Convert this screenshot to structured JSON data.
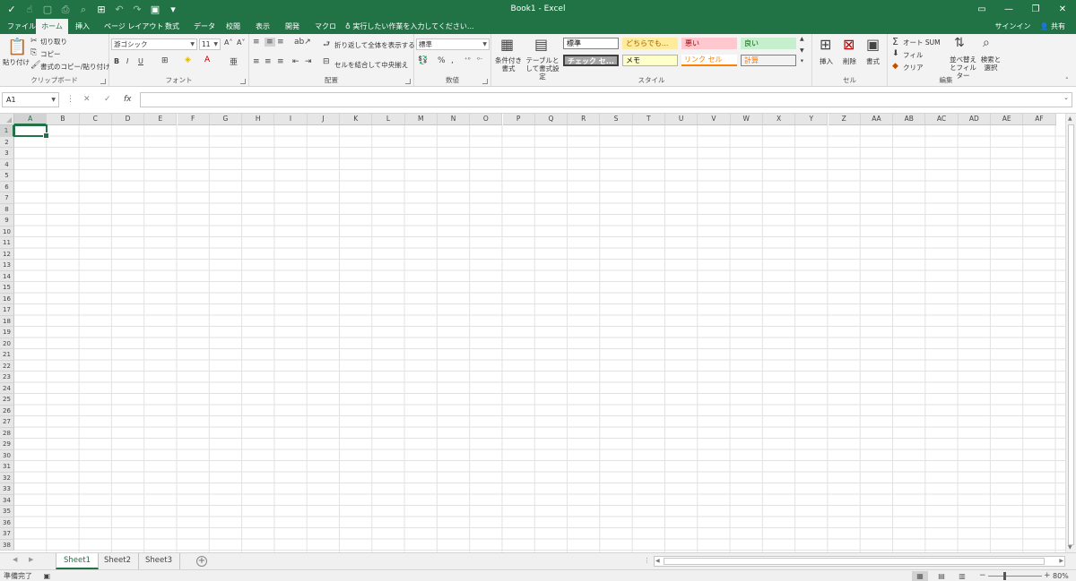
{
  "app": {
    "title": "Book1 - Excel"
  },
  "qat": {
    "check": "✓",
    "undo": "↶",
    "redo": "↷",
    "save": "💾",
    "more": "⇟"
  },
  "tabs": [
    {
      "label": "ファイル",
      "active": false
    },
    {
      "label": "ホーム",
      "active": true
    },
    {
      "label": "挿入",
      "active": false
    },
    {
      "label": "ページ レイアウト",
      "active": false
    },
    {
      "label": "数式",
      "active": false
    },
    {
      "label": "データ",
      "active": false
    },
    {
      "label": "校閲",
      "active": false
    },
    {
      "label": "表示",
      "active": false
    },
    {
      "label": "開発",
      "active": false
    },
    {
      "label": "マクロ",
      "active": false
    }
  ],
  "search": {
    "placeholder": "実行したい作業を入力してください..."
  },
  "account": {
    "signin": "サインイン",
    "share": "共有"
  },
  "ribbon": {
    "clipboard": {
      "label": "クリップボード",
      "paste": "貼り付け",
      "cut": "切り取り",
      "copy": "コピー",
      "format_painter": "書式のコピー/貼り付け"
    },
    "font": {
      "label": "フォント",
      "name": "游ゴシック",
      "size": "11",
      "bold": "B",
      "italic": "I",
      "underline": "U"
    },
    "alignment": {
      "label": "配置",
      "wrap": "折り返して全体を表示する",
      "merge": "セルを結合して中央揃え"
    },
    "number": {
      "label": "数値",
      "format": "標準",
      "percent": "%",
      "comma": ","
    },
    "styles": {
      "label": "スタイル",
      "conditional": "条件付き書式",
      "table": "テーブルとして書式設定",
      "cells": [
        {
          "label": "標準",
          "bg": "#ffffff",
          "fg": "#000000",
          "border": "#7f7f7f"
        },
        {
          "label": "どちらでも...",
          "bg": "#ffeb9c",
          "fg": "#9c6500",
          "border": "#ffeb9c"
        },
        {
          "label": "悪い",
          "bg": "#ffc7ce",
          "fg": "#9c0006",
          "border": "#ffc7ce"
        },
        {
          "label": "良い",
          "bg": "#c6efce",
          "fg": "#006100",
          "border": "#c6efce"
        },
        {
          "label": "チェック セ...",
          "bg": "#a5a5a5",
          "fg": "#ffffff",
          "border": "#3f3f3f"
        },
        {
          "label": "メモ",
          "bg": "#ffffcc",
          "fg": "#000000",
          "border": "#b2b2b2"
        },
        {
          "label": "リンク セル",
          "bg": "#ffffff",
          "fg": "#fa7d00",
          "border": "#ff8001"
        },
        {
          "label": "計算",
          "bg": "#f2f2f2",
          "fg": "#fa7d00",
          "border": "#7f7f7f"
        }
      ]
    },
    "cellsgroup": {
      "label": "セル",
      "insert": "挿入",
      "delete": "削除",
      "format": "書式"
    },
    "editing": {
      "label": "編集",
      "autosum": "オート SUM",
      "fill": "フィル",
      "clear": "クリア",
      "sort": "並べ替えとフィルター",
      "find": "検索と選択"
    }
  },
  "formula_bar": {
    "name_box": "A1",
    "fx": "fx",
    "cancel": "✕",
    "enter": "✓",
    "value": ""
  },
  "grid": {
    "columns": [
      "A",
      "B",
      "C",
      "D",
      "E",
      "F",
      "G",
      "H",
      "I",
      "J",
      "K",
      "L",
      "M",
      "N",
      "O",
      "P",
      "Q",
      "R",
      "S",
      "T",
      "U",
      "V",
      "W",
      "X",
      "Y",
      "Z",
      "AA",
      "AB",
      "AC",
      "AD",
      "AE",
      "AF"
    ],
    "rows": [
      "1",
      "2",
      "3",
      "4",
      "5",
      "6",
      "7",
      "8",
      "9",
      "10",
      "11",
      "12",
      "13",
      "14",
      "15",
      "16",
      "17",
      "18",
      "19",
      "20",
      "21",
      "22",
      "23",
      "24",
      "25",
      "26",
      "27",
      "28",
      "29",
      "30",
      "31",
      "32",
      "33",
      "34",
      "35",
      "36",
      "37",
      "38"
    ],
    "selected_col": "A",
    "selected_row": "1"
  },
  "sheets": [
    {
      "name": "Sheet1",
      "active": true
    },
    {
      "name": "Sheet2",
      "active": false
    },
    {
      "name": "Sheet3",
      "active": false
    }
  ],
  "status": {
    "ready": "準備完了",
    "zoom": "80%",
    "minus": "−",
    "plus": "+"
  },
  "colors": {
    "accent": "#217346"
  }
}
